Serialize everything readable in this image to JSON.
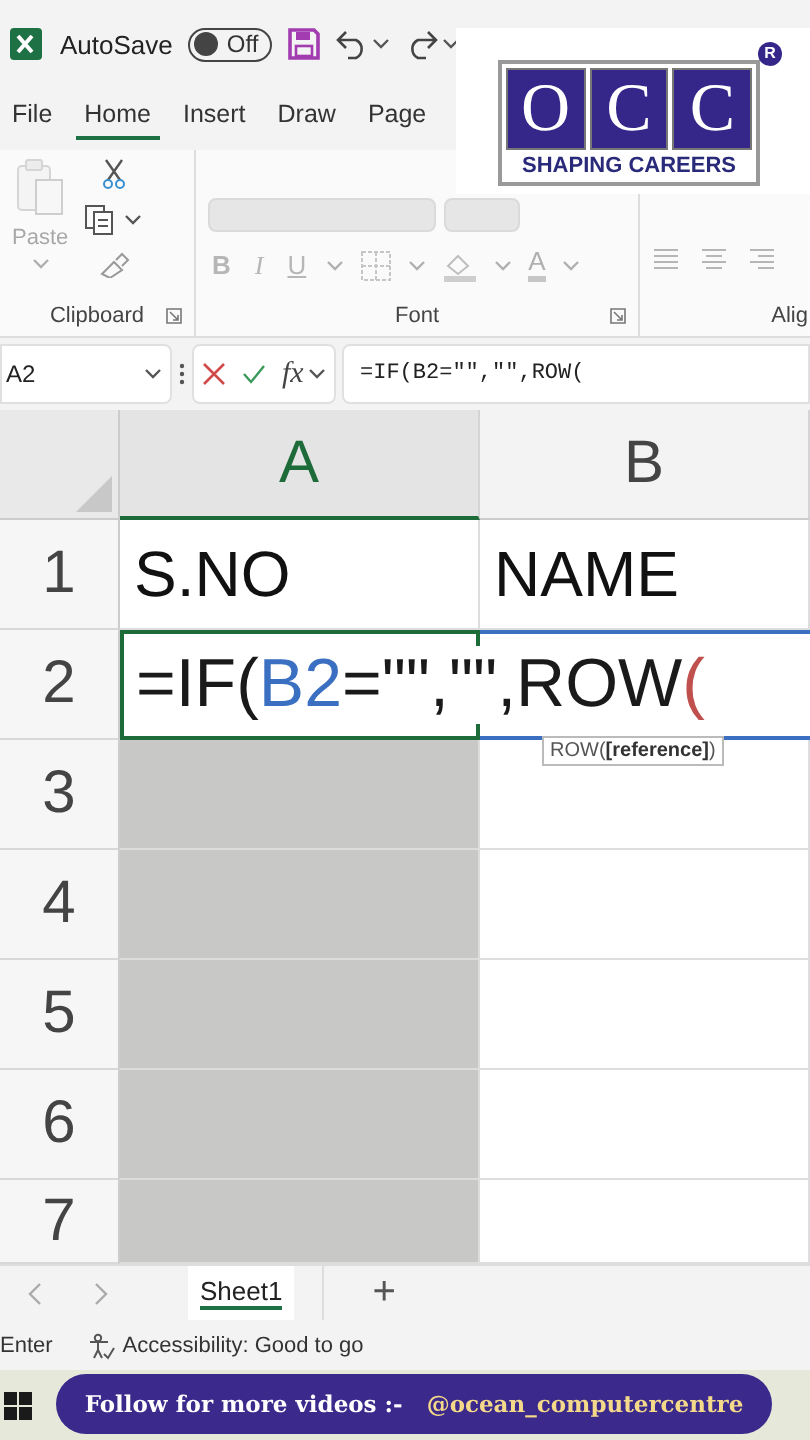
{
  "title_bar": {
    "autosave_label": "AutoSave",
    "autosave": {
      "on": false,
      "label": "Off"
    }
  },
  "logo": {
    "letters": [
      "O",
      "C",
      "C"
    ],
    "tagline": "SHAPING CAREERS",
    "registered": "R"
  },
  "tabs": [
    {
      "label": "File",
      "selected": false
    },
    {
      "label": "Home",
      "selected": true
    },
    {
      "label": "Insert",
      "selected": false
    },
    {
      "label": "Draw",
      "selected": false
    },
    {
      "label": "Page",
      "selected": false
    }
  ],
  "ribbon": {
    "disabled": true,
    "paste_label": "Paste",
    "font_buttons": [
      "B",
      "I",
      "U"
    ],
    "font_color_label": "A",
    "groups": [
      {
        "label": "Clipboard",
        "kind": "clipboard"
      },
      {
        "label": "Font",
        "kind": "font"
      },
      {
        "label": "Alig",
        "kind": "alignment"
      }
    ]
  },
  "formula_bar": {
    "name_box": "A2",
    "fx_label": "fx",
    "formula": "=IF(B2=\"\",\"\",ROW("
  },
  "grid": {
    "columns": [
      {
        "label": "A",
        "selected": true
      },
      {
        "label": "B",
        "selected": false
      }
    ],
    "rows": [
      {
        "label": "1",
        "cells": [
          {
            "kind": "text",
            "text": "S.NO",
            "selected": false
          },
          {
            "kind": "text",
            "text": "NAME",
            "selected": false
          }
        ]
      },
      {
        "label": "2",
        "cells": [
          {
            "kind": "formula",
            "parts": [
              {
                "text": "=IF(",
                "color": "#1a1a1a"
              },
              {
                "text": "B2",
                "color": "#3b6fc2"
              },
              {
                "text": "=\"\",\"\",ROW",
                "color": "#1a1a1a"
              },
              {
                "text": "(",
                "color": "#c0504d"
              }
            ],
            "tooltip": "ROW(**[reference]**)"
          }
        ]
      },
      {
        "label": "3",
        "cells": [
          {
            "kind": "empty",
            "selected": true
          },
          {
            "kind": "empty",
            "selected": false
          }
        ]
      },
      {
        "label": "4",
        "cells": [
          {
            "kind": "empty",
            "selected": true
          },
          {
            "kind": "empty",
            "selected": false
          }
        ]
      },
      {
        "label": "5",
        "cells": [
          {
            "kind": "empty",
            "selected": true
          },
          {
            "kind": "empty",
            "selected": false
          }
        ]
      },
      {
        "label": "6",
        "cells": [
          {
            "kind": "empty",
            "selected": true
          },
          {
            "kind": "empty",
            "selected": false
          }
        ]
      },
      {
        "label": "7",
        "cells": [
          {
            "kind": "empty",
            "selected": true
          },
          {
            "kind": "empty",
            "selected": false
          }
        ]
      }
    ]
  },
  "sheet_tabs": {
    "tabs": [
      {
        "label": "Sheet1",
        "selected": true
      }
    ],
    "add_label": "+"
  },
  "status_bar": {
    "mode": "Enter",
    "accessibility": "Accessibility: Good to go"
  },
  "banner": {
    "text": "Follow for more videos :-",
    "handle": "@ocean_computercentre"
  }
}
